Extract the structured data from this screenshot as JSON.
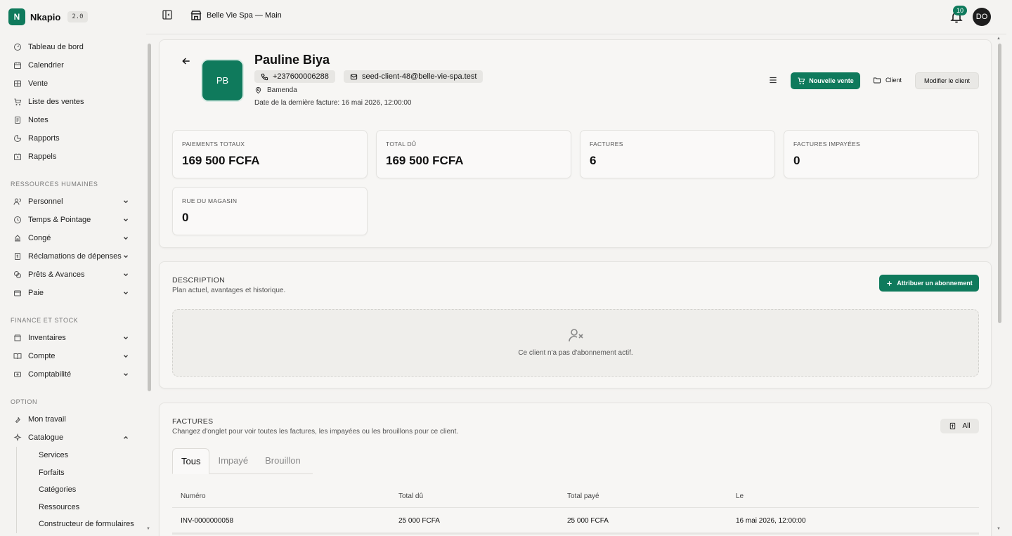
{
  "brand": {
    "name": "Nkapio",
    "logo_letter": "N",
    "version": "2.0"
  },
  "colors": {
    "accent": "#0f7a5c",
    "background": "#f4f3f1",
    "avatar_dark": "#1e1e1e"
  },
  "sidebar": {
    "main_items": [
      {
        "label": "Tableau de bord",
        "icon": "dashboard-icon"
      },
      {
        "label": "Calendrier",
        "icon": "calendar-icon"
      },
      {
        "label": "Vente",
        "icon": "pos-icon"
      },
      {
        "label": "Liste des ventes",
        "icon": "cart-icon"
      },
      {
        "label": "Notes",
        "icon": "notes-icon"
      },
      {
        "label": "Rapports",
        "icon": "chart-icon"
      },
      {
        "label": "Rappels",
        "icon": "reminder-icon"
      }
    ],
    "hr_section": "Ressources humaines",
    "hr_items": [
      {
        "label": "Personnel",
        "icon": "users-icon"
      },
      {
        "label": "Temps & Pointage",
        "icon": "clock-icon"
      },
      {
        "label": "Congé",
        "icon": "leave-icon"
      },
      {
        "label": "Réclamations de dépenses",
        "icon": "receipt-icon"
      },
      {
        "label": "Prêts & Avances",
        "icon": "coins-icon"
      },
      {
        "label": "Paie",
        "icon": "wallet-icon"
      }
    ],
    "finance_section": "Finance et stock",
    "finance_items": [
      {
        "label": "Inventaires",
        "icon": "store-icon"
      },
      {
        "label": "Compte",
        "icon": "book-icon"
      },
      {
        "label": "Comptabilité",
        "icon": "calculator-icon"
      }
    ],
    "option_section": "Option",
    "option_items": [
      {
        "label": "Mon travail",
        "icon": "wrench-icon"
      },
      {
        "label": "Catalogue",
        "icon": "sparkles-icon"
      }
    ],
    "catalogue_sub": [
      "Services",
      "Forfaits",
      "Catégories",
      "Ressources",
      "Constructeur de formulaires"
    ]
  },
  "topbar": {
    "store_name": "Belle Vie Spa — Main",
    "notifications": "10",
    "user_initials": "DO"
  },
  "client": {
    "initials": "PB",
    "name": "Pauline Biya",
    "phone": "+237600006288",
    "email": "seed-client-48@belle-vie-spa.test",
    "city": "Bamenda",
    "last_invoice": "Date de la dernière facture: 16 mai 2026, 12:00:00"
  },
  "actions": {
    "new_sale": "Nouvelle vente",
    "client": "Client",
    "edit_client": "Modifier le client"
  },
  "stats": [
    {
      "label": "Paiements totaux",
      "value": "169 500 FCFA"
    },
    {
      "label": "Total dû",
      "value": "169 500 FCFA"
    },
    {
      "label": "Factures",
      "value": "6"
    },
    {
      "label": "Factures impayées",
      "value": "0"
    },
    {
      "label": "Rue du magasin",
      "value": "0"
    }
  ],
  "subscription": {
    "title": "Description",
    "subtitle": "Plan actuel, avantages et historique.",
    "assign_button": "Attribuer un abonnement",
    "empty_text": "Ce client n'a pas d'abonnement actif."
  },
  "invoices": {
    "title": "Factures",
    "subtitle": "Changez d'onglet pour voir toutes les factures, les impayées ou les brouillons pour ce client.",
    "filter_button": "All",
    "tabs": [
      "Tous",
      "Impayé",
      "Brouillon"
    ],
    "columns": [
      "Numéro",
      "Total dû",
      "Total payé",
      "Le"
    ],
    "rows": [
      [
        "INV-0000000058",
        "25 000 FCFA",
        "25 000 FCFA",
        "16 mai 2026, 12:00:00"
      ]
    ]
  }
}
